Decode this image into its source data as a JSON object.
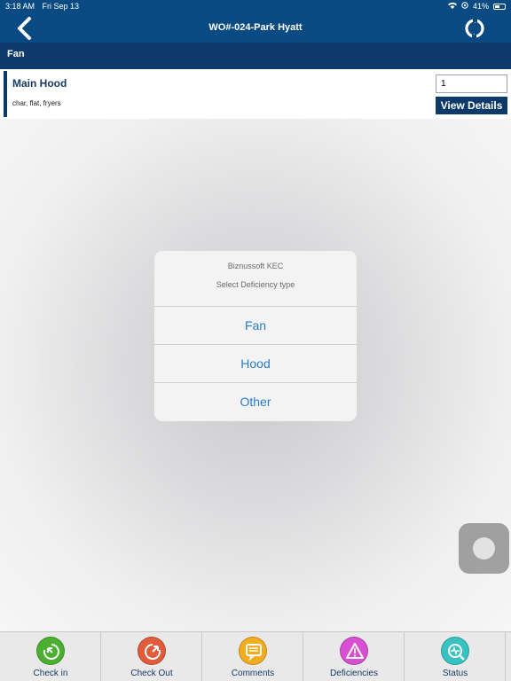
{
  "status_bar": {
    "time": "3:18 AM",
    "date": "Fri Sep 13",
    "battery": "41%"
  },
  "nav": {
    "title": "WO#-024-Park Hyatt",
    "back_icon": "chevron-left-icon",
    "refresh_icon": "refresh-icon"
  },
  "section": {
    "title": "Fan"
  },
  "hood": {
    "title": "Main Hood",
    "subtitle": "char, flat, fryers",
    "quantity": "1",
    "details_label": "View Details"
  },
  "alert": {
    "title": "Biznussoft KEC",
    "message": "Select Deficiency type",
    "options": [
      "Fan",
      "Hood",
      "Other"
    ]
  },
  "tabs": [
    {
      "label": "Check in",
      "icon": "check-in-icon",
      "color": "#4bb030"
    },
    {
      "label": "Check Out",
      "icon": "check-out-icon",
      "color": "#e05c3a"
    },
    {
      "label": "Comments",
      "icon": "comments-icon",
      "color": "#f2ac1f"
    },
    {
      "label": "Deficiencies",
      "icon": "warning-icon",
      "color": "#d84fd3"
    },
    {
      "label": "Status",
      "icon": "status-icon",
      "color": "#38c2c2"
    }
  ],
  "colors": {
    "header": "#0a4a82",
    "section": "#0d3a6b",
    "accent": "#2a7cc7"
  }
}
